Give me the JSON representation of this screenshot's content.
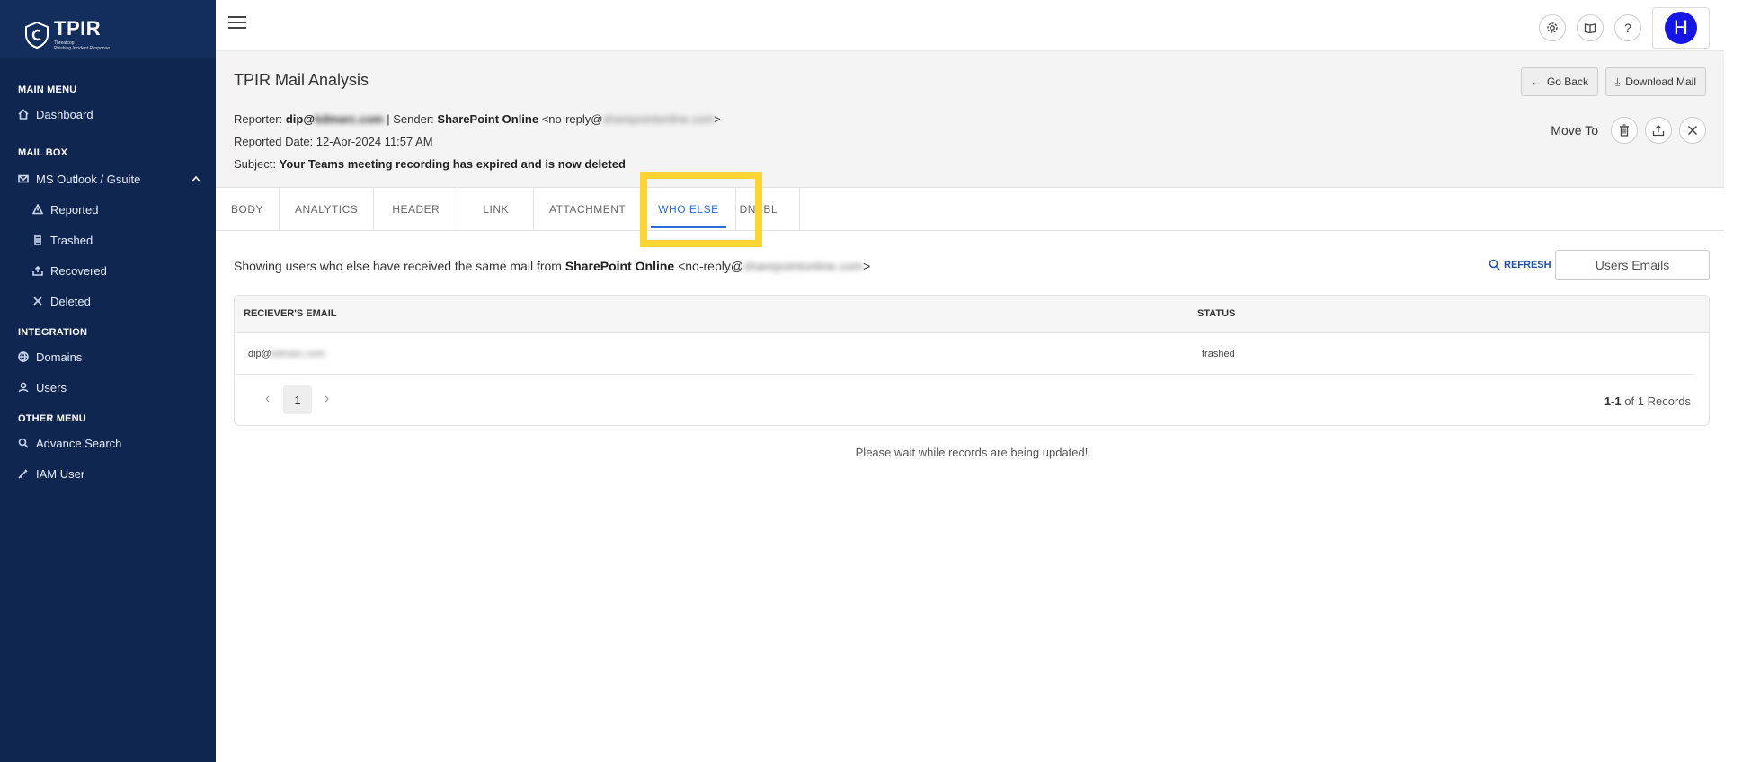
{
  "brand": {
    "name": "TPIR",
    "tagline_line1": "Threatcop",
    "tagline_line2": "Phishing Incident Response"
  },
  "sidebar": {
    "sections": [
      {
        "title": "MAIN MENU"
      },
      {
        "title": "MAIL BOX"
      },
      {
        "title": "INTEGRATION"
      },
      {
        "title": "OTHER MENU"
      }
    ],
    "items": {
      "dashboard": "Dashboard",
      "ms_outlook": "MS Outlook / Gsuite",
      "reported": "Reported",
      "trashed": "Trashed",
      "recovered": "Recovered",
      "deleted": "Deleted",
      "domains": "Domains",
      "users": "Users",
      "advance_search": "Advance Search",
      "iam_user": "IAM User"
    }
  },
  "topbar": {
    "avatar_initial": "H"
  },
  "mail": {
    "title": "TPIR Mail Analysis",
    "reporter_label": "Reporter:",
    "reporter_user": "dip@",
    "reporter_domain_blurred": "kdmarc.com",
    "sep": "|",
    "sender_label": "Sender:",
    "sender_name": "SharePoint Online",
    "sender_email_prefix": "<no-reply@",
    "sender_email_blurred": "sharepointonline.com",
    "sender_email_suffix": ">",
    "reported_date_label": "Reported Date:",
    "reported_date": "12-Apr-2024 11:57 AM",
    "subject_label": "Subject:",
    "subject": "Your Teams meeting recording has expired and is now deleted",
    "go_back": "Go Back",
    "download_mail": "Download Mail",
    "move_to": "Move To"
  },
  "tabs": [
    "BODY",
    "ANALYTICS",
    "HEADER",
    "LINK",
    "ATTACHMENT",
    "WHO ELSE",
    "DNSBL"
  ],
  "who_else": {
    "showing_prefix": "Showing users who else have received the same mail from",
    "sender_name": "SharePoint Online",
    "sender_email_prefix": "<no-reply@",
    "sender_email_blurred": "sharepointonline.com",
    "sender_email_suffix": ">",
    "refresh": "REFRESH",
    "users_emails": "Users Emails",
    "columns": [
      "RECIEVER'S EMAIL",
      "STATUS"
    ],
    "rows": [
      {
        "email_user": "dip@",
        "email_domain_blurred": "kdmarc.com",
        "status": "trashed"
      }
    ],
    "page": "1",
    "records_range": "1-1",
    "records_of": "of",
    "records_total": "1",
    "records_label": "Records",
    "wait_message": "Please wait while records are being updated!"
  },
  "colors": {
    "sidebar_bg": "#0f2651",
    "accent": "#2d6bd6",
    "highlight": "#fcd534",
    "avatar": "#1515e6"
  }
}
